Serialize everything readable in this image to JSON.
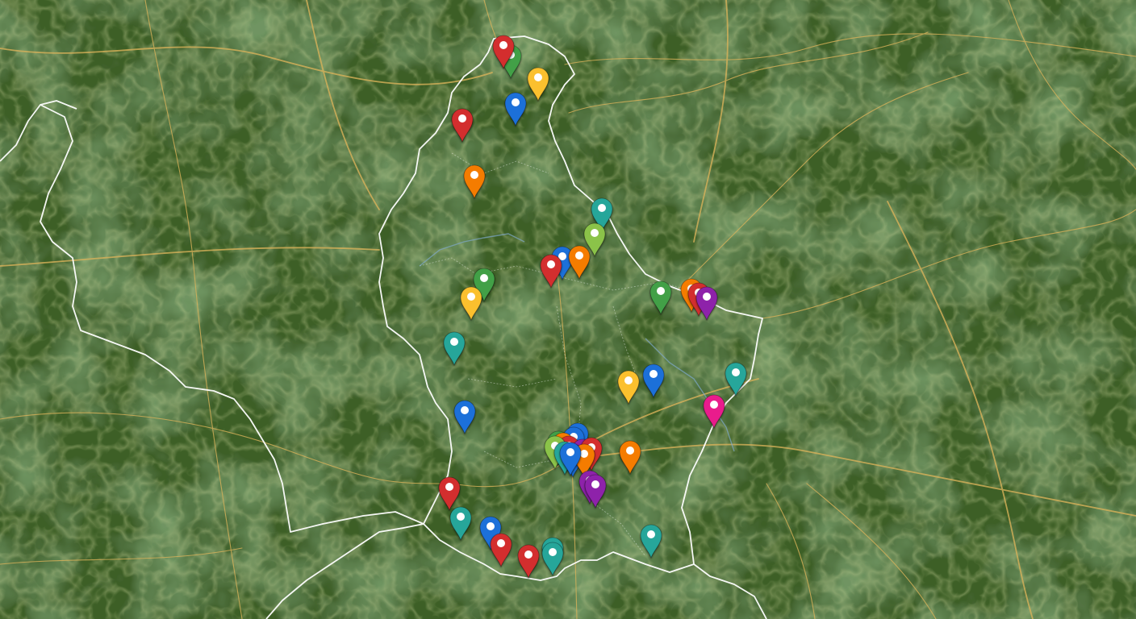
{
  "map": {
    "view": "satellite",
    "border_color": "#ffffff",
    "road_color": "#d9b25a",
    "pin_colors": {
      "red": "#d32f2f",
      "orange": "#f57c00",
      "yellow": "#fbc02d",
      "green": "#43a047",
      "lime": "#8bc34a",
      "teal": "#26a69a",
      "blue": "#1e6fd9",
      "purple": "#8e24aa",
      "pink": "#e91e8c"
    },
    "pins": [
      {
        "id": "pin-1",
        "color": "green"
      },
      {
        "id": "pin-2",
        "color": "red"
      },
      {
        "id": "pin-3",
        "color": "yellow"
      },
      {
        "id": "pin-4",
        "color": "blue"
      },
      {
        "id": "pin-5",
        "color": "red"
      },
      {
        "id": "pin-6",
        "color": "orange"
      },
      {
        "id": "pin-7",
        "color": "teal"
      },
      {
        "id": "pin-8",
        "color": "lime"
      },
      {
        "id": "pin-9",
        "color": "blue"
      },
      {
        "id": "pin-10",
        "color": "orange"
      },
      {
        "id": "pin-11",
        "color": "red"
      },
      {
        "id": "pin-12",
        "color": "green"
      },
      {
        "id": "pin-13",
        "color": "yellow"
      },
      {
        "id": "pin-14",
        "color": "teal"
      },
      {
        "id": "pin-15",
        "color": "green"
      },
      {
        "id": "pin-16",
        "color": "orange"
      },
      {
        "id": "pin-17",
        "color": "red"
      },
      {
        "id": "pin-18",
        "color": "purple"
      },
      {
        "id": "pin-19",
        "color": "yellow"
      },
      {
        "id": "pin-20",
        "color": "blue"
      },
      {
        "id": "pin-21",
        "color": "teal"
      },
      {
        "id": "pin-22",
        "color": "pink"
      },
      {
        "id": "pin-23",
        "color": "blue"
      },
      {
        "id": "pin-24",
        "color": "blue"
      },
      {
        "id": "pin-25",
        "color": "green"
      },
      {
        "id": "pin-26",
        "color": "orange"
      },
      {
        "id": "pin-27",
        "color": "red"
      },
      {
        "id": "pin-28",
        "color": "purple"
      },
      {
        "id": "pin-29",
        "color": "lime"
      },
      {
        "id": "pin-30",
        "color": "red"
      },
      {
        "id": "pin-31",
        "color": "teal"
      },
      {
        "id": "pin-32",
        "color": "blue"
      },
      {
        "id": "pin-33",
        "color": "orange"
      },
      {
        "id": "pin-34",
        "color": "blue"
      },
      {
        "id": "pin-35",
        "color": "blue"
      },
      {
        "id": "pin-36",
        "color": "purple"
      },
      {
        "id": "pin-37",
        "color": "purple"
      },
      {
        "id": "pin-38",
        "color": "red"
      },
      {
        "id": "pin-39",
        "color": "teal"
      },
      {
        "id": "pin-40",
        "color": "blue"
      },
      {
        "id": "pin-41",
        "color": "red"
      },
      {
        "id": "pin-42",
        "color": "orange"
      },
      {
        "id": "pin-43",
        "color": "red"
      },
      {
        "id": "pin-44",
        "color": "teal"
      },
      {
        "id": "pin-45",
        "color": "teal"
      },
      {
        "id": "pin-46",
        "color": "teal"
      }
    ]
  }
}
